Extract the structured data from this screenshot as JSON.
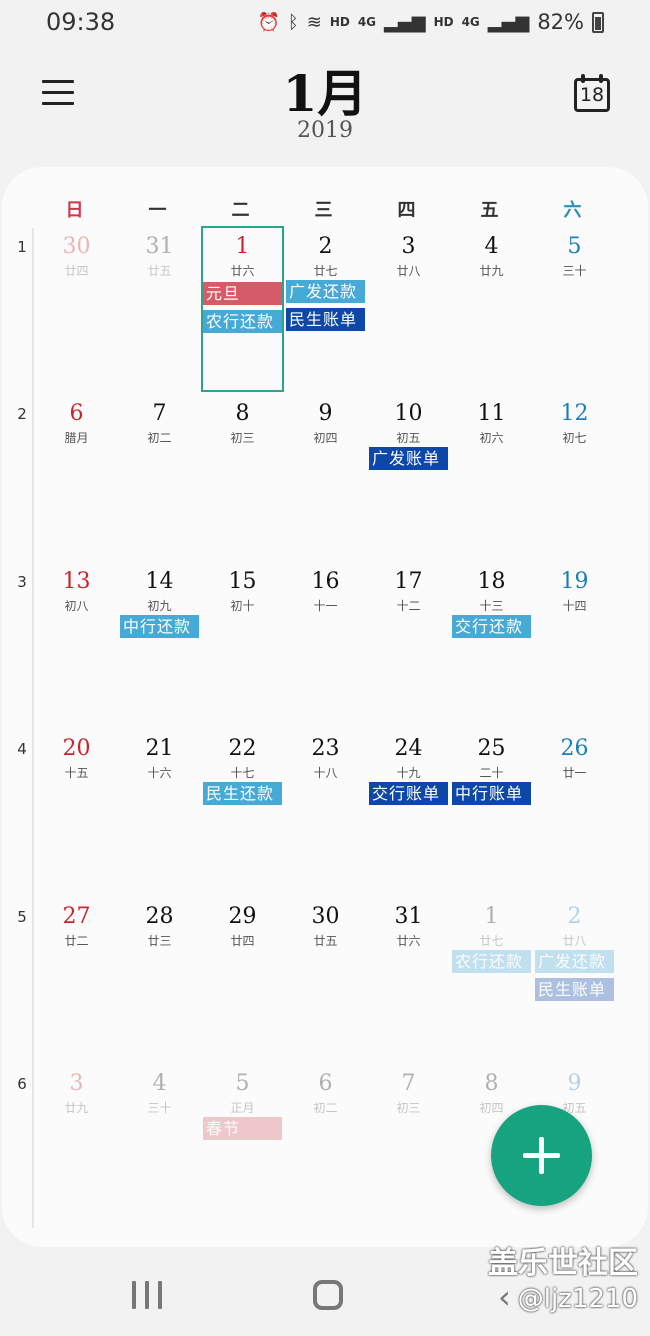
{
  "status_bar": {
    "time": "09:38",
    "icons": [
      "alarm-icon",
      "bluetooth-icon",
      "wifi-icon",
      "signal-icon",
      "signal-icon",
      "battery-icon"
    ],
    "hd1": "HD",
    "net1": "4G",
    "hd2": "HD",
    "net2": "4G",
    "battery": "82%"
  },
  "header": {
    "month": "1月",
    "year": "2019",
    "today_day": "18"
  },
  "weekdays": [
    "日",
    "一",
    "二",
    "三",
    "四",
    "五",
    "六"
  ],
  "weeks": [
    {
      "num": "1",
      "days": [
        {
          "d": "30",
          "l": "廿四",
          "dim": true,
          "events": []
        },
        {
          "d": "31",
          "l": "廿五",
          "dim": true,
          "events": []
        },
        {
          "d": "1",
          "l": "廿六",
          "today": true,
          "holiday": true,
          "events": [
            {
              "t": "元旦",
              "c": "red"
            },
            {
              "t": "农行还款",
              "c": "light"
            }
          ]
        },
        {
          "d": "2",
          "l": "廿七",
          "events": [
            {
              "t": "广发还款",
              "c": "light"
            },
            {
              "t": "民生账单",
              "c": "dark"
            }
          ]
        },
        {
          "d": "3",
          "l": "廿八",
          "events": []
        },
        {
          "d": "4",
          "l": "廿九",
          "events": []
        },
        {
          "d": "5",
          "l": "三十",
          "events": []
        }
      ]
    },
    {
      "num": "2",
      "days": [
        {
          "d": "6",
          "l": "腊月",
          "events": []
        },
        {
          "d": "7",
          "l": "初二",
          "events": []
        },
        {
          "d": "8",
          "l": "初三",
          "events": []
        },
        {
          "d": "9",
          "l": "初四",
          "events": []
        },
        {
          "d": "10",
          "l": "初五",
          "events": [
            {
              "t": "广发账单",
              "c": "dark"
            }
          ]
        },
        {
          "d": "11",
          "l": "初六",
          "events": []
        },
        {
          "d": "12",
          "l": "初七",
          "events": []
        }
      ]
    },
    {
      "num": "3",
      "days": [
        {
          "d": "13",
          "l": "初八",
          "events": []
        },
        {
          "d": "14",
          "l": "初九",
          "events": [
            {
              "t": "中行还款",
              "c": "light"
            }
          ]
        },
        {
          "d": "15",
          "l": "初十",
          "events": []
        },
        {
          "d": "16",
          "l": "十一",
          "events": []
        },
        {
          "d": "17",
          "l": "十二",
          "events": []
        },
        {
          "d": "18",
          "l": "十三",
          "events": [
            {
              "t": "交行还款",
              "c": "light"
            }
          ]
        },
        {
          "d": "19",
          "l": "十四",
          "events": []
        }
      ]
    },
    {
      "num": "4",
      "days": [
        {
          "d": "20",
          "l": "十五",
          "events": []
        },
        {
          "d": "21",
          "l": "十六",
          "events": []
        },
        {
          "d": "22",
          "l": "十七",
          "events": [
            {
              "t": "民生还款",
              "c": "light"
            }
          ]
        },
        {
          "d": "23",
          "l": "十八",
          "events": []
        },
        {
          "d": "24",
          "l": "十九",
          "events": [
            {
              "t": "交行账单",
              "c": "dark"
            }
          ]
        },
        {
          "d": "25",
          "l": "二十",
          "events": [
            {
              "t": "中行账单",
              "c": "dark"
            }
          ]
        },
        {
          "d": "26",
          "l": "廿一",
          "events": []
        }
      ]
    },
    {
      "num": "5",
      "days": [
        {
          "d": "27",
          "l": "廿二",
          "events": []
        },
        {
          "d": "28",
          "l": "廿三",
          "events": []
        },
        {
          "d": "29",
          "l": "廿四",
          "events": []
        },
        {
          "d": "30",
          "l": "廿五",
          "events": []
        },
        {
          "d": "31",
          "l": "廿六",
          "events": []
        },
        {
          "d": "1",
          "l": "廿七",
          "dim": true,
          "events": [
            {
              "t": "农行还款",
              "c": "light"
            }
          ]
        },
        {
          "d": "2",
          "l": "廿八",
          "dim": true,
          "events": [
            {
              "t": "广发还款",
              "c": "light"
            },
            {
              "t": "民生账单",
              "c": "dark"
            }
          ]
        }
      ]
    },
    {
      "num": "6",
      "days": [
        {
          "d": "3",
          "l": "廿九",
          "dim": true,
          "events": []
        },
        {
          "d": "4",
          "l": "三十",
          "dim": true,
          "events": []
        },
        {
          "d": "5",
          "l": "正月",
          "dim": true,
          "events": [
            {
              "t": "春节",
              "c": "red"
            }
          ]
        },
        {
          "d": "6",
          "l": "初二",
          "dim": true,
          "events": []
        },
        {
          "d": "7",
          "l": "初三",
          "dim": true,
          "events": []
        },
        {
          "d": "8",
          "l": "初四",
          "dim": true,
          "events": []
        },
        {
          "d": "9",
          "l": "初五",
          "dim": true,
          "events": []
        }
      ]
    }
  ],
  "fab": {
    "icon": "plus-icon"
  },
  "nav": {
    "recents_icon": "recents-icon",
    "home_icon": "home-icon",
    "back_icon": "back-icon"
  },
  "watermark": {
    "line1": "盖乐世社区",
    "line2": "@ljz1210"
  },
  "colors": {
    "accent": "#16a37f",
    "today_border": "#2aa58c",
    "sunday": "#c8242e",
    "saturday": "#1a7fb5",
    "event_red": "#d45b67",
    "event_light": "#47a9d6",
    "event_dark": "#0d47a8"
  }
}
